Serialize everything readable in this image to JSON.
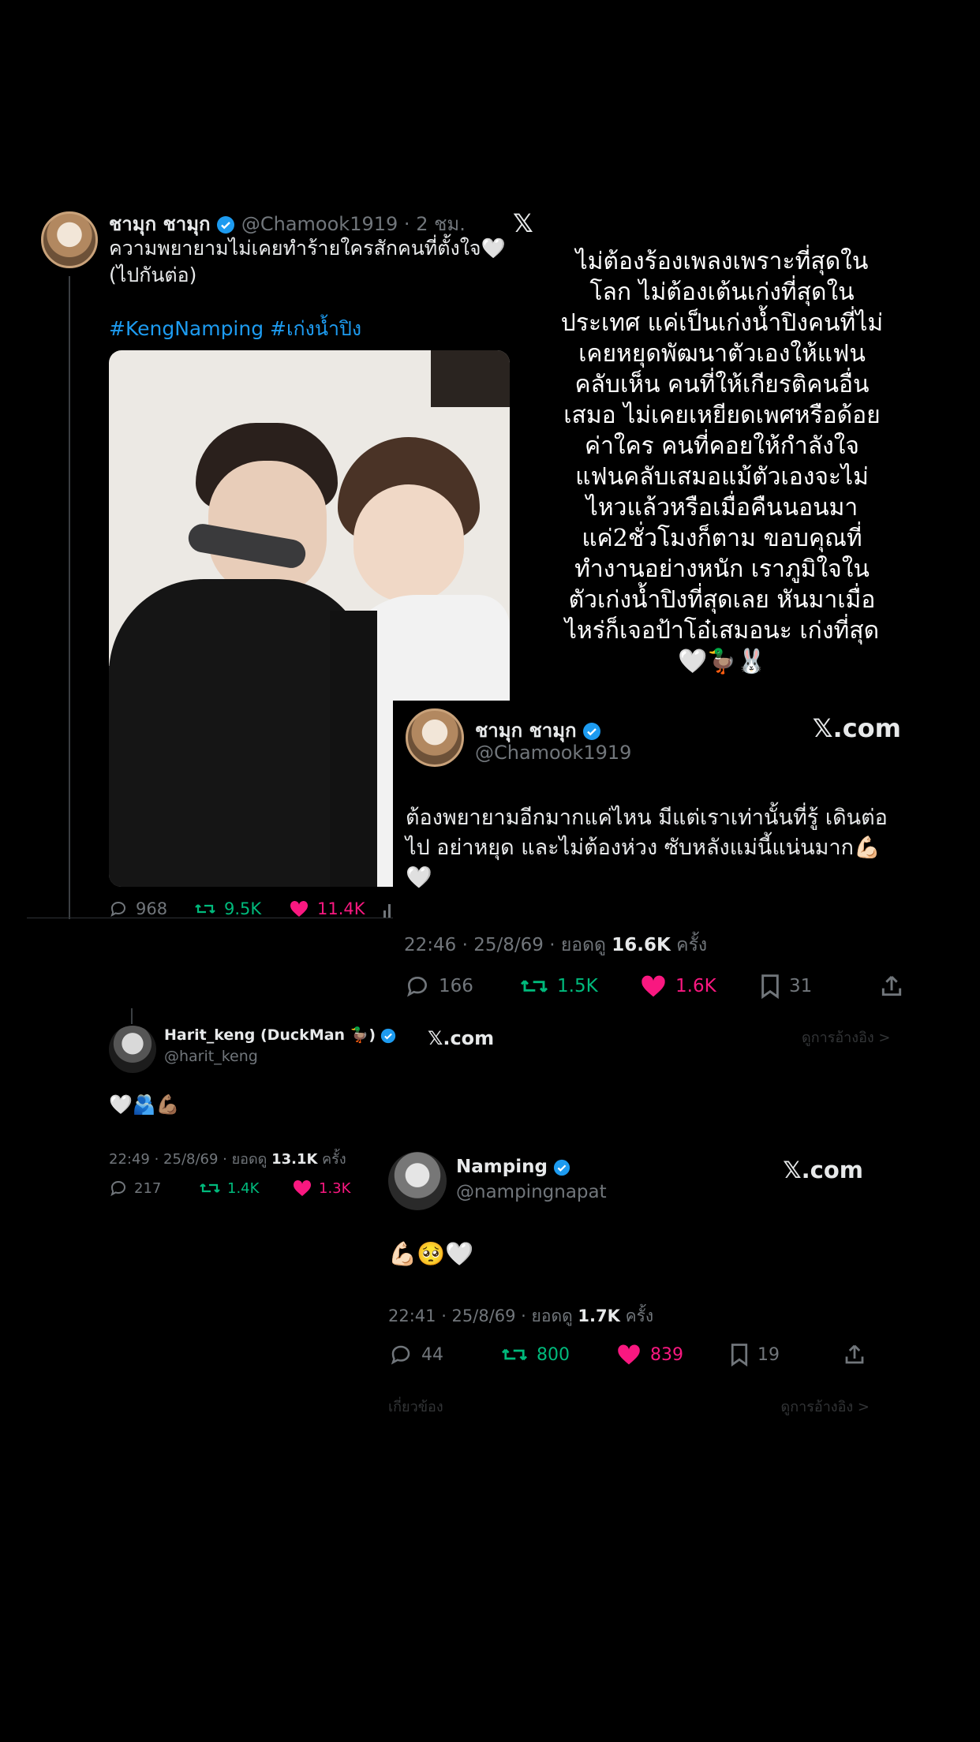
{
  "tweet1": {
    "display_name": "ชามุก ชามุก",
    "handle": "@Chamook1919",
    "time": "2 ชม.",
    "text_line1": "ความพยายามไม่เคยทำร้ายใครสักคนที่ตั้งใจ🤍",
    "text_line2": "(ไปกันต่อ)",
    "hashtags": "#KengNamping #เก่งน้ำปิง",
    "stats": {
      "replies": "968",
      "retweets": "9.5K",
      "likes": "11.4K"
    }
  },
  "caption": {
    "lines": [
      "ไม่ต้องร้องเพลงเพราะที่สุดใน",
      "โลก ไม่ต้องเต้นเก่งที่สุดใน",
      "ประเทศ แค่เป็นเก่งน้ำปิงคนที่ไม่",
      "เคยหยุดพัฒนาตัวเองให้แฟน",
      "คลับเห็น คนที่ให้เกียรติคนอื่น",
      "เสมอ ไม่เคยเหยียดเพศหรือด้อย",
      "ค่าใคร คนที่คอยให้กำลังใจ",
      "แฟนคลับเสมอแม้ตัวเองจะไม่",
      "ไหวแล้วหรือเมื่อคืนนอนมา",
      "แค่2ชั่วโมงก็ตาม ขอบคุณที่",
      "ทำงานอย่างหนัก เราภูมิใจใน",
      "ตัวเก่งน้ำปิงที่สุดเลย หันมาเมื่อ",
      "ไหร่ก็เจอป้าโอ๋เสมอนะ เก่งที่สุด",
      "🤍🦆🐰"
    ]
  },
  "tweet2": {
    "display_name": "ชามุก ชามุก",
    "handle": "@Chamook1919",
    "source": "𝕏.com",
    "text_line1": "ต้องพยายามอีกมากแค่ไหน มีแต่เราเท่านั้นที่รู้ เดินต่อ",
    "text_line2": "ไป อย่าหยุด และไม่ต้องห่วง ซับหลังแม่นี้แน่นมาก💪🏻",
    "text_line3": "🤍",
    "meta_time": "22:46 · 25/8/69 · ยอดดู ",
    "meta_views": "16.6K",
    "meta_suffix": " ครั้ง",
    "stats": {
      "replies": "166",
      "retweets": "1.5K",
      "likes": "1.6K",
      "bookmarks": "31"
    }
  },
  "tweet3": {
    "display_name": "Harit_keng (DuckMan 🦆)",
    "handle": "@harit_keng",
    "source": "𝕏.com",
    "faded_link": "ดูการอ้างอิง >",
    "text": "🤍🫂💪🏽",
    "meta_time": "22:49 · 25/8/69 · ยอดดู ",
    "meta_views": "13.1K",
    "meta_suffix": " ครั้ง",
    "stats": {
      "replies": "217",
      "retweets": "1.4K",
      "likes": "1.3K"
    }
  },
  "tweet4": {
    "display_name": "Namping",
    "handle": "@nampingnapat",
    "source": "𝕏.com",
    "text": "💪🏻🥺🤍",
    "meta_time": "22:41 · 25/8/69 · ยอดดู ",
    "meta_views": "1.7K",
    "meta_suffix": " ครั้ง",
    "stats": {
      "replies": "44",
      "retweets": "800",
      "likes": "839",
      "bookmarks": "19"
    },
    "faded_left": "เกี่ยวข้อง",
    "faded_right": "ดูการอ้างอิง >"
  },
  "colors": {
    "background": "#000000",
    "text": "#e7e9ea",
    "secondary": "#71767b",
    "blue": "#1d9bf0",
    "retweet": "#00ba7c",
    "like": "#f91880"
  }
}
